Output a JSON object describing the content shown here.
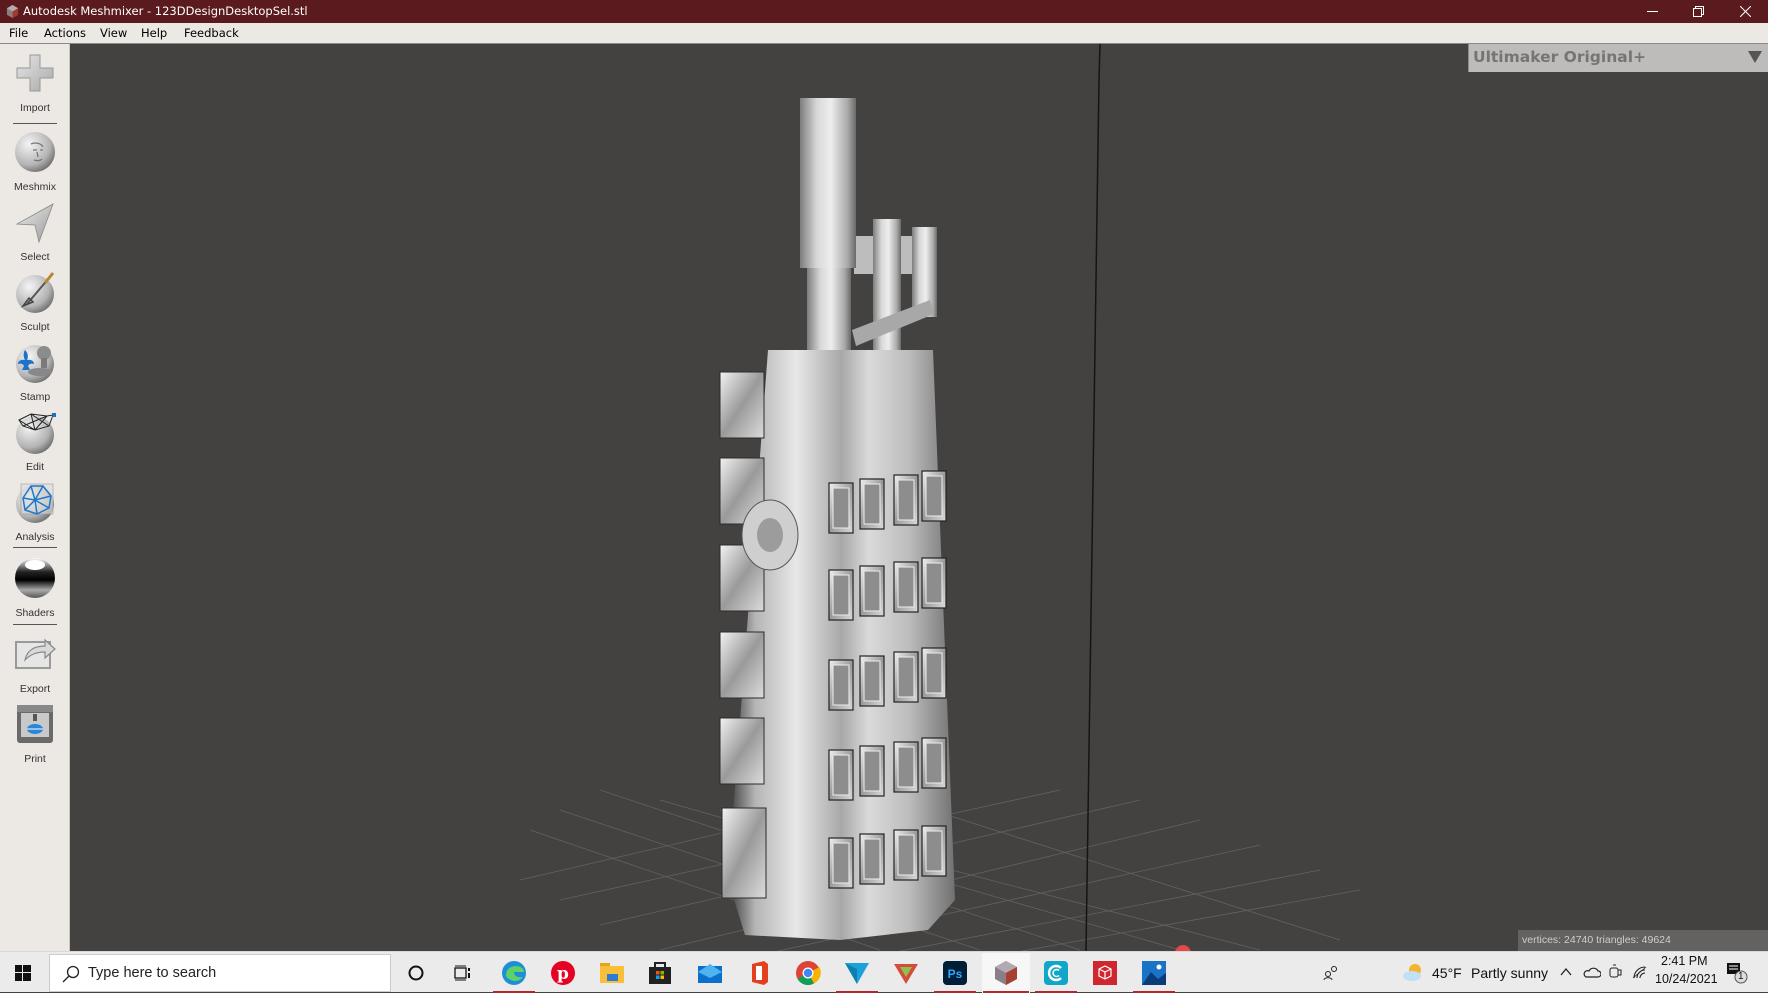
{
  "window": {
    "title": "Autodesk Meshmixer - 123DDesignDesktopSel.stl",
    "controls": [
      "minimize",
      "restore",
      "close"
    ]
  },
  "menubar": {
    "items": [
      {
        "label": "File"
      },
      {
        "label": "Actions"
      },
      {
        "label": "View"
      },
      {
        "label": "Help"
      },
      {
        "label": "Feedback"
      }
    ]
  },
  "toolbar": {
    "tools": [
      {
        "label": "Import",
        "icon": "plus-icon"
      },
      {
        "label": "Meshmix",
        "icon": "face-sphere-icon"
      },
      {
        "label": "Select",
        "icon": "arrow-pointer-icon"
      },
      {
        "label": "Sculpt",
        "icon": "brush-sphere-icon"
      },
      {
        "label": "Stamp",
        "icon": "fleur-de-lis-stamp-icon"
      },
      {
        "label": "Edit",
        "icon": "wireframe-sphere-icon"
      },
      {
        "label": "Analysis",
        "icon": "mesh-analysis-icon"
      },
      {
        "label": "Shaders",
        "icon": "chrome-sphere-icon"
      },
      {
        "label": "Export",
        "icon": "export-arrow-icon"
      },
      {
        "label": "Print",
        "icon": "3d-printer-icon"
      }
    ]
  },
  "viewport": {
    "printer": "Ultimaker Original+",
    "stats": "vertices: 24740 triangles: 49624",
    "colors": {
      "background": "#434240",
      "mesh": "#c8c8c8",
      "grid": "#6a6a68"
    }
  },
  "taskbar": {
    "search_placeholder": "Type here to search",
    "apps": [
      {
        "name": "cortana",
        "active": false
      },
      {
        "name": "task-view",
        "active": false
      },
      {
        "name": "edge",
        "running": true
      },
      {
        "name": "pinterest",
        "running": false
      },
      {
        "name": "file-explorer",
        "running": false
      },
      {
        "name": "store",
        "running": false
      },
      {
        "name": "mail",
        "running": false
      },
      {
        "name": "office",
        "running": false
      },
      {
        "name": "chrome",
        "running": false
      },
      {
        "name": "app-blue-triangle",
        "running": true
      },
      {
        "name": "app-red-triangle",
        "running": false
      },
      {
        "name": "photoshop",
        "running": true
      },
      {
        "name": "meshmixer",
        "running": true,
        "active": true
      },
      {
        "name": "app-c",
        "running": true
      },
      {
        "name": "app-red-box",
        "running": false
      },
      {
        "name": "photos",
        "running": true
      }
    ],
    "weather": {
      "temp": "45°F",
      "condition": "Partly sunny"
    },
    "time": "2:41 PM",
    "date": "10/24/2021",
    "notifications": "1"
  }
}
